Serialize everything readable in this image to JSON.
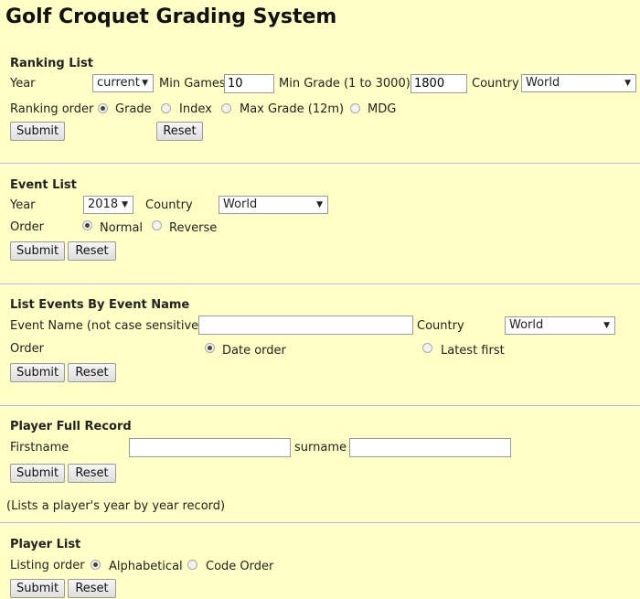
{
  "page_title": "Golf Croquet Grading System",
  "ranking": {
    "title": "Ranking List",
    "year_label": "Year",
    "year_value": "current",
    "min_games_label": "Min Games",
    "min_games_value": "10",
    "min_grade_label": "Min Grade (1 to 3000)",
    "min_grade_value": "1800",
    "country_label": "Country",
    "country_value": "World",
    "order_label": "Ranking order",
    "order_options": [
      {
        "label": "Grade",
        "checked": true
      },
      {
        "label": "Index",
        "checked": false
      },
      {
        "label": "Max Grade (12m)",
        "checked": false
      },
      {
        "label": "MDG",
        "checked": false
      }
    ],
    "submit": "Submit",
    "reset": "Reset"
  },
  "events": {
    "title": "Event List",
    "year_label": "Year",
    "year_value": "2018",
    "country_label": "Country",
    "country_value": "World",
    "order_label": "Order",
    "order_options": [
      {
        "label": "Normal",
        "checked": true
      },
      {
        "label": "Reverse",
        "checked": false
      }
    ],
    "submit": "Submit",
    "reset": "Reset"
  },
  "events_by_name": {
    "title": "List Events By Event Name",
    "name_label": "Event Name (not case sensitive)",
    "name_value": "",
    "country_label": "Country",
    "country_value": "World",
    "order_label": "Order",
    "order_options": [
      {
        "label": "Date order",
        "checked": true
      },
      {
        "label": "Latest first",
        "checked": false
      }
    ],
    "submit": "Submit",
    "reset": "Reset"
  },
  "player_record": {
    "title": "Player Full Record",
    "firstname_label": "Firstname",
    "firstname_value": "",
    "surname_label": "surname",
    "surname_value": "",
    "submit": "Submit",
    "reset": "Reset",
    "note": "(Lists a player's year by year record)"
  },
  "player_list": {
    "title": "Player List",
    "order_label": "Listing order",
    "order_options": [
      {
        "label": "Alphabetical",
        "checked": true
      },
      {
        "label": "Code Order",
        "checked": false
      }
    ],
    "submit": "Submit",
    "reset": "Reset"
  },
  "colors": {
    "background": "#ffffc6",
    "divider": "#bdbdbd"
  }
}
